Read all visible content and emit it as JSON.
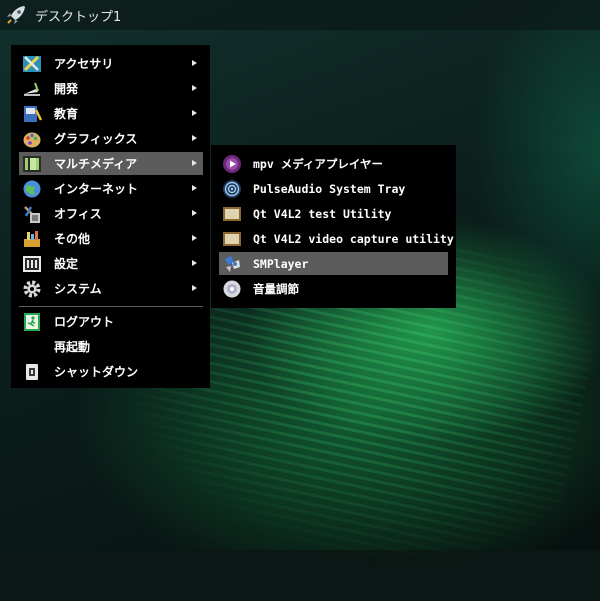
{
  "taskbar": {
    "desktop_label": "デスクトップ1",
    "launcher_icon": "rocket-icon"
  },
  "main_menu": {
    "items": [
      {
        "label": "アクセサリ",
        "icon": "accessories-icon"
      },
      {
        "label": "開発",
        "icon": "development-icon"
      },
      {
        "label": "教育",
        "icon": "education-icon"
      },
      {
        "label": "グラフィックス",
        "icon": "graphics-icon"
      },
      {
        "label": "マルチメディア",
        "icon": "multimedia-icon",
        "highlighted": true
      },
      {
        "label": "インターネット",
        "icon": "internet-icon"
      },
      {
        "label": "オフィス",
        "icon": "office-icon"
      },
      {
        "label": "その他",
        "icon": "other-icon"
      },
      {
        "label": "設定",
        "icon": "settings-icon"
      },
      {
        "label": "システム",
        "icon": "system-icon"
      }
    ],
    "session": [
      {
        "label": "ログアウト",
        "icon": "logout-icon"
      },
      {
        "label": "再起動",
        "icon": ""
      },
      {
        "label": "シャットダウン",
        "icon": "shutdown-icon"
      }
    ]
  },
  "submenu": {
    "items": [
      {
        "label": "mpv メディアプレイヤー",
        "icon": "mpv-icon"
      },
      {
        "label": "PulseAudio System Tray",
        "icon": "pulseaudio-icon"
      },
      {
        "label": "Qt V4L2 test Utility",
        "icon": "qv4l2-icon"
      },
      {
        "label": "Qt V4L2 video capture utility",
        "icon": "qvidcap-icon"
      },
      {
        "label": "SMPlayer",
        "icon": "smplayer-icon",
        "highlighted": true
      },
      {
        "label": "音量調節",
        "icon": "volume-control-icon"
      }
    ]
  },
  "colors": {
    "menu_bg": "#000000",
    "highlight": "#5c5c5c",
    "text": "#ffffff"
  }
}
